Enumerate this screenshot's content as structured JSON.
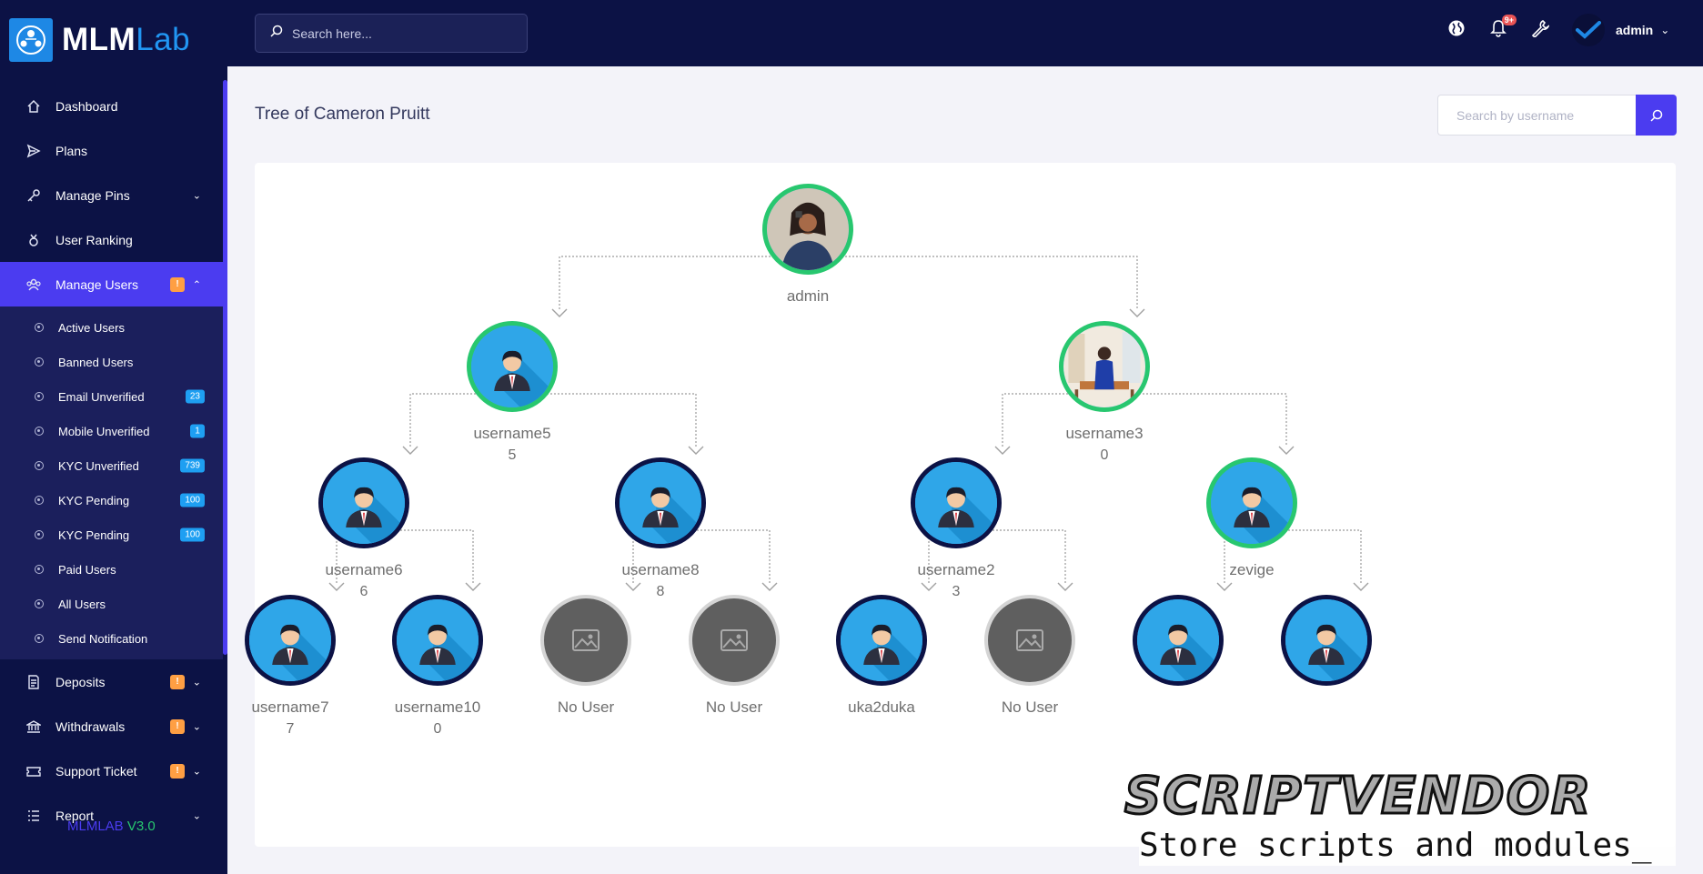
{
  "brand": {
    "name_main": "MLM",
    "name_sub": "Lab"
  },
  "sidebar": {
    "items": [
      {
        "label": "Dashboard",
        "icon": "home-icon"
      },
      {
        "label": "Plans",
        "icon": "send-icon"
      },
      {
        "label": "Manage Pins",
        "icon": "key-icon",
        "has_caret": true
      },
      {
        "label": "User Ranking",
        "icon": "medal-icon"
      },
      {
        "label": "Manage Users",
        "icon": "users-icon",
        "badge": "!",
        "active": true,
        "expanded": true
      },
      {
        "label": "Deposits",
        "icon": "receipt-icon",
        "badge": "!"
      },
      {
        "label": "Withdrawals",
        "icon": "bank-icon",
        "badge": "!"
      },
      {
        "label": "Support Ticket",
        "icon": "ticket-icon",
        "badge": "!"
      },
      {
        "label": "Report",
        "icon": "list-icon"
      }
    ],
    "sub_items": [
      {
        "label": "Active Users"
      },
      {
        "label": "Banned Users"
      },
      {
        "label": "Email Unverified",
        "count": "23"
      },
      {
        "label": "Mobile Unverified",
        "count": "1"
      },
      {
        "label": "KYC Unverified",
        "count": "739"
      },
      {
        "label": "KYC Pending",
        "count": "100"
      },
      {
        "label": "KYC Pending",
        "count": "100"
      },
      {
        "label": "Paid Users"
      },
      {
        "label": "All Users"
      },
      {
        "label": "Send Notification"
      }
    ],
    "version_name": "MLMLAB",
    "version_number": "V3.0"
  },
  "topbar": {
    "search_placeholder": "Search here...",
    "notification_count": "9+",
    "admin_name": "admin"
  },
  "page": {
    "title": "Tree of Cameron Pruitt",
    "user_search_placeholder": "Search by username"
  },
  "tree": {
    "root": {
      "username": "admin",
      "id": "",
      "status": "photo-woman"
    },
    "level1": [
      {
        "username": "username5",
        "id": "5",
        "status": "paid"
      },
      {
        "username": "username3",
        "id": "0",
        "status": "photo-man"
      }
    ],
    "level2": [
      {
        "username": "username6",
        "id": "6",
        "status": "free"
      },
      {
        "username": "username8",
        "id": "8",
        "status": "free"
      },
      {
        "username": "username2",
        "id": "3",
        "status": "free"
      },
      {
        "username": "zevige",
        "id": "",
        "status": "paid"
      }
    ],
    "level3": [
      {
        "username": "username7",
        "id": "7",
        "status": "free"
      },
      {
        "username": "username10",
        "id": "0",
        "status": "free"
      },
      {
        "username": "No User",
        "id": "",
        "status": "empty"
      },
      {
        "username": "No User",
        "id": "",
        "status": "empty"
      },
      {
        "username": "uka2duka",
        "id": "",
        "status": "free"
      },
      {
        "username": "No User",
        "id": "",
        "status": "empty"
      },
      {
        "username": "",
        "id": "",
        "status": "free"
      },
      {
        "username": "",
        "id": "",
        "status": "free"
      }
    ]
  },
  "watermark": {
    "title": "SCRIPTVENDOR",
    "tagline": "Store scripts and modules_"
  },
  "colors": {
    "sidebar_bg": "#0c1245",
    "accent": "#4b3cf0",
    "paid_ring": "#28c76f",
    "warn": "#ff9f43",
    "info": "#1e9ff2"
  }
}
